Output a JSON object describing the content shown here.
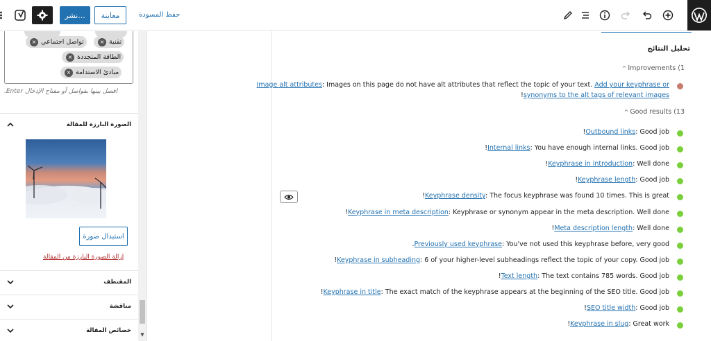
{
  "topbar": {
    "save_draft": "حفظ المسودة",
    "preview": "معاينة",
    "publish": "نشر..."
  },
  "sidebar": {
    "tags": [
      "تقنية",
      "تواصل اجتماعي",
      "الطاقة المتجددة",
      "مبادئ الاستدامة"
    ],
    "tags_help": "افصل بينها بفواصل أو مفتاح الإدخال Enter.",
    "featured_image": {
      "title": "الصورة البارزة للمقالة",
      "replace_label": "استبدال صورة",
      "remove_label": "إزالة الصورة البارزة من المقالة"
    },
    "panels": [
      "المقتطف",
      "مناقشة",
      "خصائص المقالة"
    ]
  },
  "analysis": {
    "title": "تحليل النتائج",
    "improvements_header": "Improvements (1",
    "good_header": "Good results (13",
    "improvements": [
      {
        "line1_link": "Image alt attributes",
        "line1_text": ": Images on this page do not have alt attributes that reflect the topic of your text. ",
        "line1_link2": "Add your keyphrase or",
        "line2_link": "synonyms to the alt tags of relevant images",
        "line2_suffix": "!",
        "color": "#dc3232"
      }
    ],
    "good": [
      {
        "link": "Outbound links",
        "text": ": Good job!"
      },
      {
        "link": "Internal links",
        "text": ": You have enough internal links. Good job!"
      },
      {
        "link": "Keyphrase in introduction",
        "text": ": Well done!"
      },
      {
        "link": "Keyphrase length",
        "text": ": Good job!"
      },
      {
        "link": "Keyphrase density",
        "text": ": The focus keyphrase was found 10 times. This is great!"
      },
      {
        "link": "Keyphrase in meta description",
        "text": ": Keyphrase or synonym appear in the meta description. Well done!"
      },
      {
        "link": "Meta description length",
        "text": ": Well done!"
      },
      {
        "link": "Previously used keyphrase",
        "text": ": You've not used this keyphrase before, very good."
      },
      {
        "link": "Keyphrase in subheading",
        "text": ": 6 of your higher-level subheadings reflect the topic of your copy. Good job!"
      },
      {
        "link": "Text length",
        "text": ": The text contains 785 words. Good job!"
      },
      {
        "link": "Keyphrase in title",
        "text": ": The exact match of the keyphrase appears at the beginning of the SEO title. Good job!"
      },
      {
        "link": "SEO title width",
        "text": ": Good job!"
      },
      {
        "link": "Keyphrase in slug",
        "text": ": Great work!"
      }
    ],
    "good_color": "#7ad03a",
    "improvement_color": "#dc3232"
  }
}
